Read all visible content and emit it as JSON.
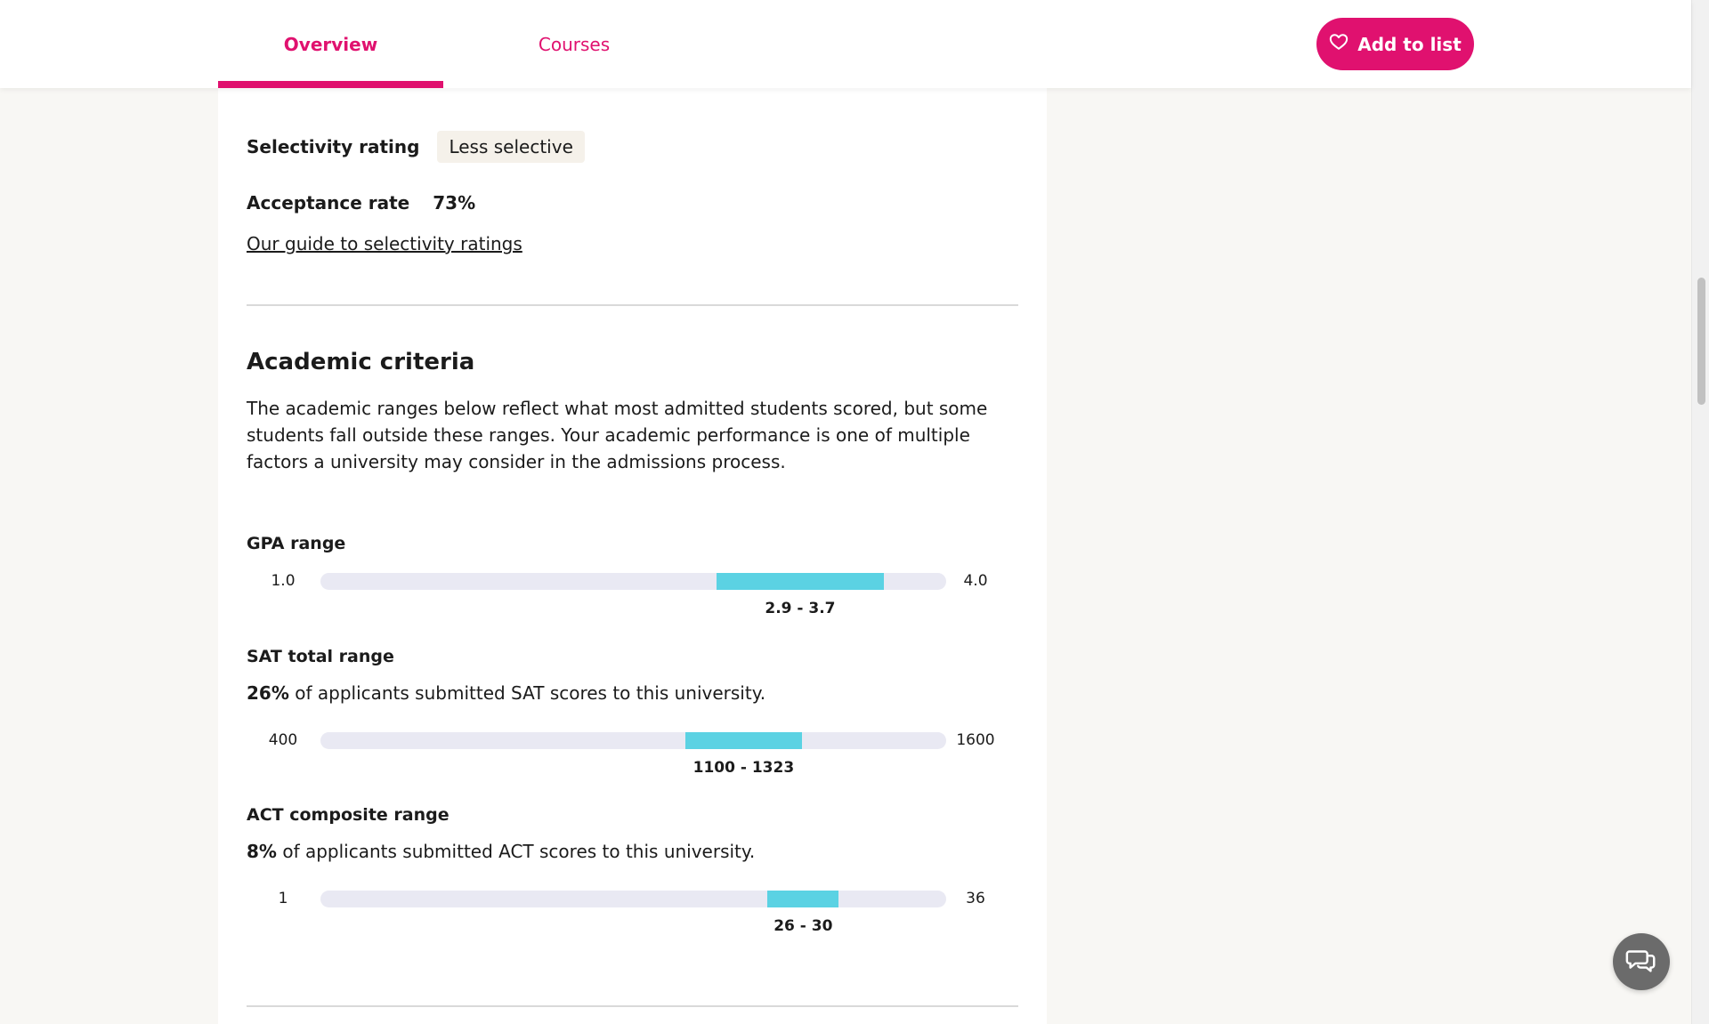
{
  "nav": {
    "tabs": [
      {
        "label": "Overview",
        "active": true
      },
      {
        "label": "Courses",
        "active": false
      }
    ],
    "add_button_label": "Add to list",
    "accent_color": "#e0116f"
  },
  "selectivity": {
    "label": "Selectivity rating",
    "value": "Less selective",
    "acceptance_label": "Acceptance rate",
    "acceptance_value": "73%",
    "guide_link": "Our guide to selectivity ratings"
  },
  "academic": {
    "title": "Academic criteria",
    "intro": "The academic ranges below reflect what most admitted students scored, but some students fall outside these ranges. Your academic performance is one of multiple factors a university may consider in the admissions process.",
    "ranges": [
      {
        "key": "gpa",
        "title": "GPA range",
        "min": 1.0,
        "max": 4.0,
        "min_label": "1.0",
        "max_label": "4.0",
        "low": 2.9,
        "high": 3.7,
        "range_label": "2.9 - 3.7"
      },
      {
        "key": "sat",
        "title": "SAT total range",
        "note_strong": "26%",
        "note_rest": " of applicants submitted SAT scores to this university.",
        "min": 400,
        "max": 1600,
        "min_label": "400",
        "max_label": "1600",
        "low": 1100,
        "high": 1323,
        "range_label": "1100 - 1323"
      },
      {
        "key": "act",
        "title": "ACT composite range",
        "note_strong": "8%",
        "note_rest": " of applicants submitted ACT scores to this university.",
        "min": 1,
        "max": 36,
        "min_label": "1",
        "max_label": "36",
        "low": 26,
        "high": 30,
        "range_label": "26 - 30"
      }
    ],
    "bar_color": "#5bd2e3",
    "track_color": "#e9e9f3"
  },
  "icons": {
    "add_button_icon": "heart-outline-icon",
    "chat_icon": "chat-bubbles-icon"
  }
}
